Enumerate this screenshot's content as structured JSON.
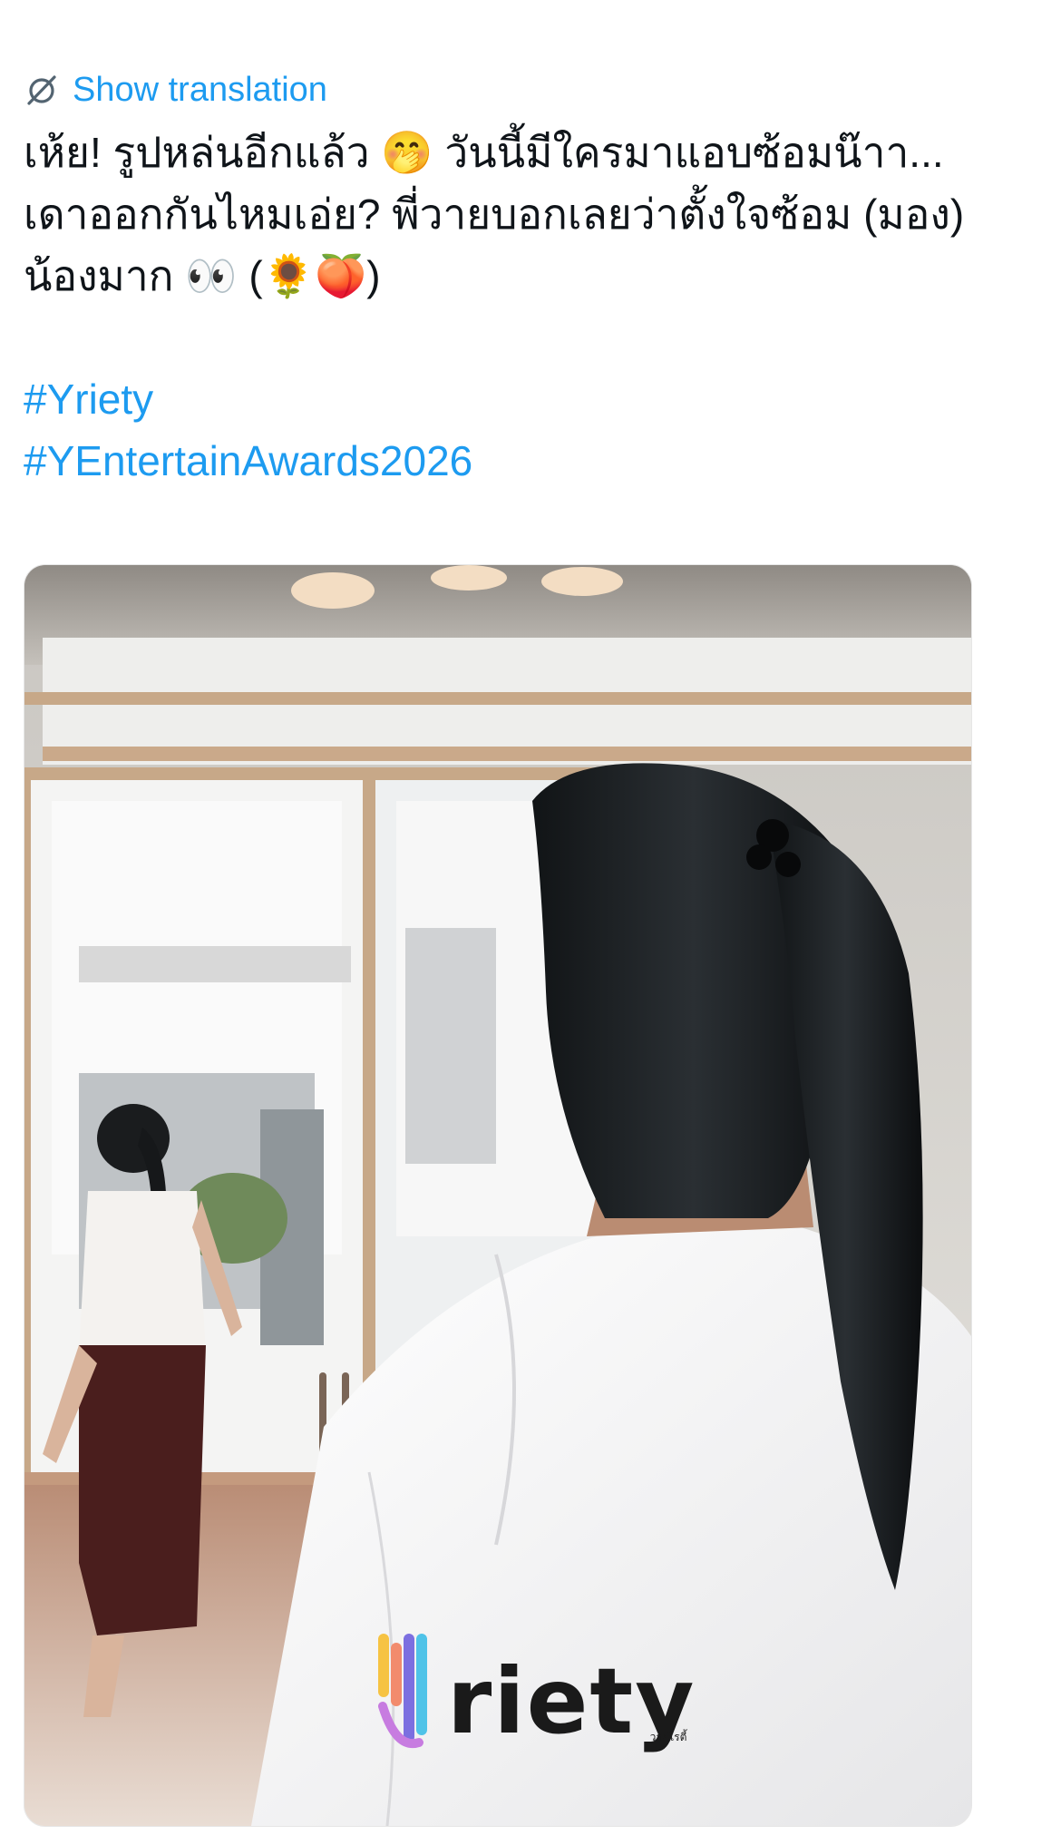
{
  "translate": {
    "label": "Show translation",
    "icon": "no-translate-icon"
  },
  "tweet": {
    "lines": [
      "เห้ย! รูปหล่นอีกแล้ว 🤭 วันนี้มีใครมาแอบซ้อมน๊าา...",
      "เดาออกกันไหมเอ่ย? พี่วายบอกเลยว่าตั้งใจซ้อม (มอง)",
      "น้องมาก 👀 (🌻🍑)"
    ],
    "hashtags": [
      "#Yriety",
      "#YEntertainAwards2026"
    ]
  },
  "media": {
    "watermark_text": "riety",
    "watermark_subtext": "วายไรตี้"
  },
  "colors": {
    "link": "#1d9bf0",
    "text": "#0f1419"
  }
}
